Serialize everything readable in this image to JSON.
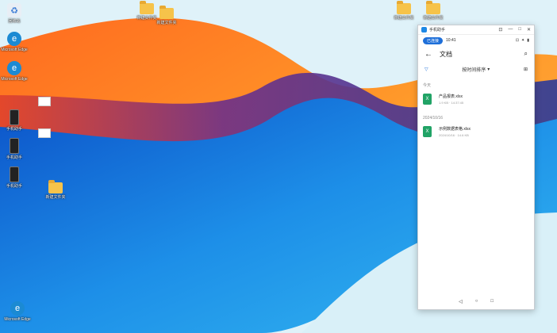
{
  "desktop": {
    "icons": [
      {
        "label": "回收站",
        "kind": "recycle"
      },
      {
        "label": "Microsoft Edge",
        "kind": "edge"
      },
      {
        "label": "Microsoft Edge",
        "kind": "edge"
      },
      {
        "label": "手机助手",
        "kind": "phone"
      },
      {
        "label": "手机助手",
        "kind": "phone"
      },
      {
        "label": "手机助手",
        "kind": "phone"
      },
      {
        "label": "Microsoft Edge",
        "kind": "edge"
      },
      {
        "label": "",
        "kind": "card"
      },
      {
        "label": "",
        "kind": "card"
      },
      {
        "label": "新建文件夹",
        "kind": "folder"
      },
      {
        "label": "新建文件夹",
        "kind": "folder"
      },
      {
        "label": "新建文件夹",
        "kind": "folder"
      },
      {
        "label": "新建文件夹",
        "kind": "folder"
      },
      {
        "label": "新建文件夹",
        "kind": "folder"
      }
    ]
  },
  "phone_window": {
    "title": "手机助手",
    "win_buttons": [
      "⊡",
      "—",
      "□",
      "✕"
    ],
    "status": {
      "pill": "已连接",
      "time": "10:41",
      "right": [
        "⊡",
        "✦",
        "▮"
      ]
    },
    "header": {
      "back": "←",
      "title": "文档",
      "search": "⌕"
    },
    "filter": {
      "filter_icon": "▽",
      "sort_label": "按时间排序",
      "sort_arrow": "▾",
      "grid_icon": "⊞"
    },
    "sections": [
      {
        "label": "今天",
        "files": [
          {
            "name": "产品报表.xlsx",
            "meta": "1.9 KB · 14:37:45"
          }
        ]
      },
      {
        "label": "2024/10/16",
        "files": [
          {
            "name": "示例数据表格.xlsx",
            "meta": "2024/10/16 · 14.6 KB"
          }
        ]
      }
    ],
    "navbar": [
      "◁",
      "○",
      "□"
    ]
  }
}
